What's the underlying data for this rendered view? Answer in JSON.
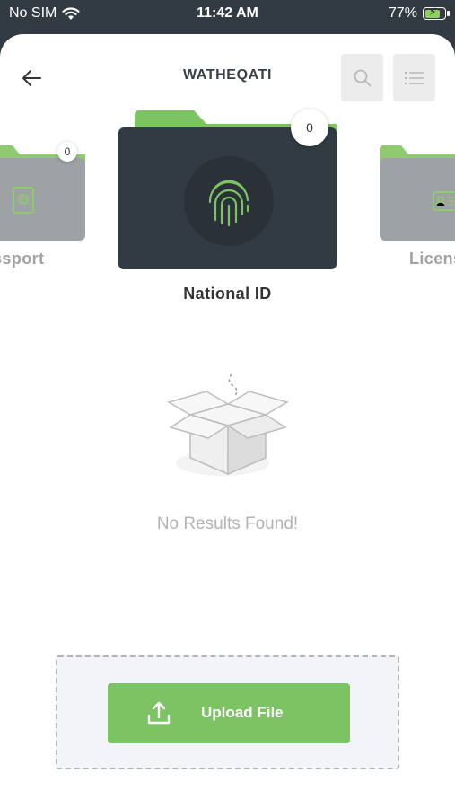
{
  "status_bar": {
    "carrier": "No SIM",
    "time": "11:42 AM",
    "battery_percent": "77%",
    "battery_level": 0.77
  },
  "header": {
    "title": "WATHEQATI"
  },
  "folders": [
    {
      "label": "ssport",
      "count": "0",
      "icon": "passport-icon"
    },
    {
      "label": "National ID",
      "count": "0",
      "icon": "fingerprint-icon"
    },
    {
      "label": "Licens",
      "icon": "license-card-icon"
    }
  ],
  "empty_state": {
    "message": "No Results Found!",
    "icon": "empty-box-icon"
  },
  "upload": {
    "label": "Upload File",
    "icon": "upload-icon"
  },
  "colors": {
    "accent": "#7cc364",
    "folder_active": "#323b43",
    "folder_inactive": "#9fa2a5",
    "status_bar_bg": "#323b43"
  }
}
